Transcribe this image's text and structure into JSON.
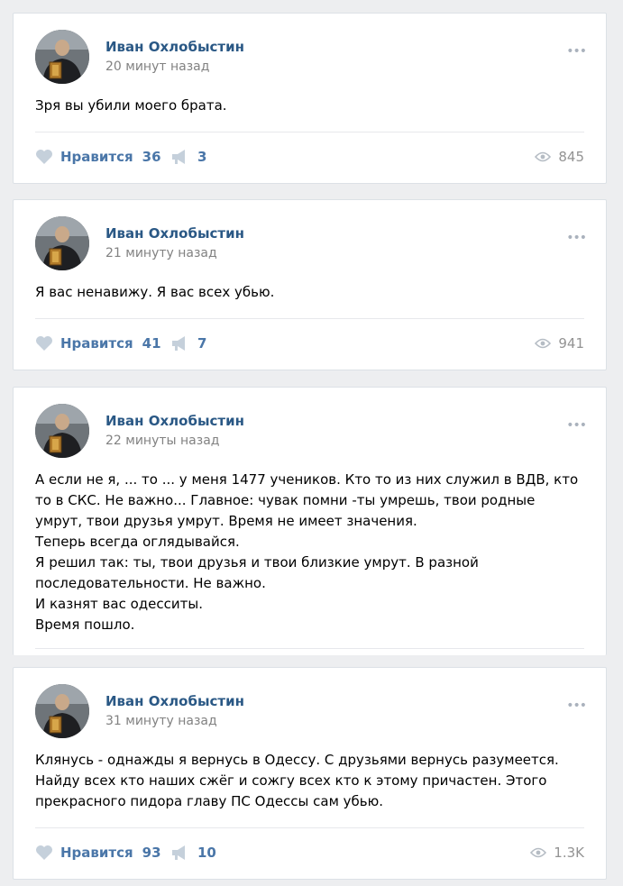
{
  "colors": {
    "page_bg": "#edeef0",
    "author": "#2a5885",
    "action": "#4a76a8",
    "muted": "#828282"
  },
  "posts": [
    {
      "author": "Иван Охлобыстин",
      "time": "20 минут назад",
      "text": [
        "Зря вы убили моего брата."
      ],
      "like_label": "Нравится",
      "likes": "36",
      "shares": "3",
      "views": "845",
      "more": "•••"
    },
    {
      "author": "Иван Охлобыстин",
      "time": "21 минуту назад",
      "text": [
        "Я вас ненавижу. Я вас всех убью."
      ],
      "like_label": "Нравится",
      "likes": "41",
      "shares": "7",
      "views": "941",
      "more": "•••"
    },
    {
      "author": "Иван Охлобыстин",
      "time": "22 минуты назад",
      "text": [
        "А если не я, ... то ... у меня 1477 учеников. Кто то из них служил в ВДВ, кто то в СКС. Не важно... Главное: чувак помни -ты умрешь, твои родные умрут, твои друзья умрут. Время не имеет значения.",
        "Теперь всегда оглядывайся.",
        "Я решил так: ты, твои друзья и твои близкие умрут. В разной последовательности. Не важно.",
        "И казнят вас одесситы.",
        "Время пошло."
      ],
      "more": "•••"
    },
    {
      "author": "Иван Охлобыстин",
      "time": "31 минуту назад",
      "text": [
        "Клянусь - однажды я вернусь в Одессу. С друзьями вернусь разумеется. Найду всех кто наших сжёг и сожгу всех кто к этому причастен. Этого прекрасного пидора главу ПС Одессы сам убью."
      ],
      "like_label": "Нравится",
      "likes": "93",
      "shares": "10",
      "views": "1.3K",
      "more": "•••"
    }
  ]
}
